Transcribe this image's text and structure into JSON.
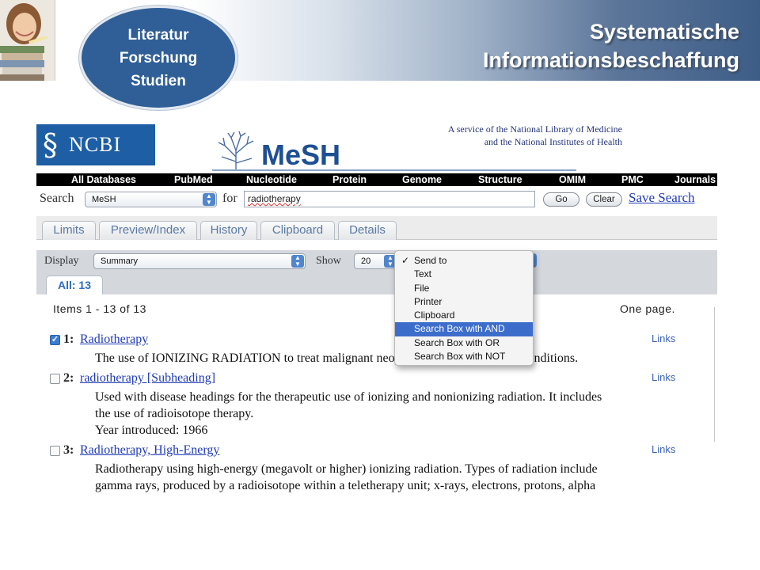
{
  "slide": {
    "topic": [
      "Literatur",
      "Forschung",
      "Studien"
    ],
    "title_lines": [
      "Systematische",
      "Informationsbeschaffung"
    ]
  },
  "brand": {
    "ncbi": "NCBI",
    "mesh": "MeSH",
    "service_lines": [
      "A service of the National Library of Medicine",
      "and the National Institutes of Health"
    ]
  },
  "navbar": [
    "All Databases",
    "PubMed",
    "Nucleotide",
    "Protein",
    "Genome",
    "Structure",
    "OMIM",
    "PMC",
    "Journals"
  ],
  "search": {
    "label": "Search",
    "database": "MeSH",
    "for_label": "for",
    "query": "radiotherapy",
    "go": "Go",
    "clear": "Clear",
    "save_search": "Save Search"
  },
  "tabs": [
    "Limits",
    "Preview/Index",
    "History",
    "Clipboard",
    "Details"
  ],
  "display": {
    "label": "Display",
    "format": "Summary",
    "show_label": "Show",
    "show_value": "20",
    "result_tab": "All: 13"
  },
  "results": {
    "items_count": "Items 1 - 13 of 13",
    "pages": "One page.",
    "items": [
      {
        "num": "1:",
        "title": "Radiotherapy",
        "checked": true,
        "links": "Links",
        "desc": [
          "The use of IONIZING RADIATION to treat malignant neoplasms and some benign conditions."
        ]
      },
      {
        "num": "2:",
        "title": "radiotherapy [Subheading]",
        "checked": false,
        "links": "Links",
        "desc": [
          "Used with disease headings for the therapeutic use of ionizing and nonionizing radiation. It includes",
          "the use of radioisotope therapy.",
          "Year introduced: 1966"
        ]
      },
      {
        "num": "3:",
        "title": "Radiotherapy, High-Energy",
        "checked": false,
        "links": "Links",
        "desc": [
          "Radiotherapy using high-energy (megavolt or higher) ionizing radiation. Types of radiation include",
          "gamma rays, produced by a radioisotope within a teletherapy unit; x-rays, electrons, protons, alpha"
        ]
      }
    ]
  },
  "send_to_menu": {
    "items": [
      "Send to",
      "Text",
      "File",
      "Printer",
      "Clipboard",
      "Search Box with AND",
      "Search Box with OR",
      "Search Box with NOT"
    ],
    "checked": "Send to",
    "highlighted": "Search Box with AND"
  }
}
